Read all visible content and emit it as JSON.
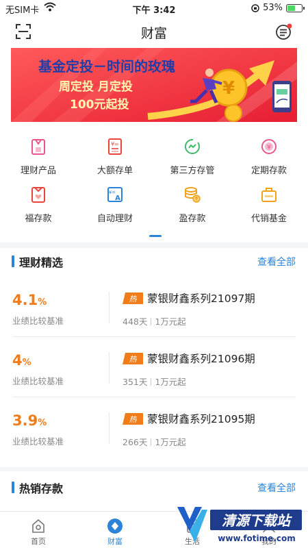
{
  "status_bar": {
    "carrier": "无SIM卡",
    "time": "下午 3:42",
    "battery": "53%",
    "battery_level": 0.53
  },
  "header": {
    "title": "财富"
  },
  "banner": {
    "headline": "基金定投－时间的玫瑰",
    "line2": "周定投 月定投",
    "line3": "100元起投",
    "coin_symbol": "¥"
  },
  "menu": [
    {
      "label": "理财产品",
      "icon": "wealth-product-icon",
      "color": "#e8578f"
    },
    {
      "label": "大额存单",
      "icon": "certificate-icon",
      "color": "#e8453c"
    },
    {
      "label": "第三方存管",
      "icon": "third-party-icon",
      "color": "#3fb86a"
    },
    {
      "label": "定期存款",
      "icon": "fixed-deposit-icon",
      "color": "#e8578f"
    },
    {
      "label": "福存款",
      "icon": "fu-deposit-icon",
      "color": "#e8453c"
    },
    {
      "label": "自动理财",
      "icon": "auto-finance-icon",
      "color": "#2b84d8"
    },
    {
      "label": "盈存款",
      "icon": "coins-icon",
      "color": "#f0a21c"
    },
    {
      "label": "代销基金",
      "icon": "briefcase-icon",
      "color": "#f0a21c"
    }
  ],
  "featured": {
    "title": "理财精选",
    "more": "查看全部",
    "products": [
      {
        "rate": "4.1",
        "unit": "%",
        "rate_label": "业绩比较基准",
        "hot": "热",
        "name": "蒙银财鑫系列21097期",
        "days": "448天",
        "min": "1万元起"
      },
      {
        "rate": "4",
        "unit": "%",
        "rate_label": "业绩比较基准",
        "hot": "热",
        "name": "蒙银财鑫系列21096期",
        "days": "351天",
        "min": "1万元起"
      },
      {
        "rate": "3.9",
        "unit": "%",
        "rate_label": "业绩比较基准",
        "hot": "热",
        "name": "蒙银财鑫系列21095期",
        "days": "266天",
        "min": "1万元起"
      }
    ]
  },
  "hot_deposit": {
    "title": "热销存款",
    "more": "查看全部"
  },
  "tabbar": [
    {
      "label": "首页",
      "icon": "home-icon",
      "active": false
    },
    {
      "label": "财富",
      "icon": "wealth-icon",
      "active": true
    },
    {
      "label": "生活",
      "icon": "life-icon",
      "active": false
    },
    {
      "label": "我的",
      "icon": "profile-icon",
      "active": false
    }
  ],
  "watermark": {
    "text": "清源下载站",
    "url": "www.fotime.com"
  },
  "colors": {
    "accent": "#2b84d8",
    "rate": "#f07d1a",
    "badge": "#f07d1a",
    "banner_bg": "#f0283c"
  }
}
